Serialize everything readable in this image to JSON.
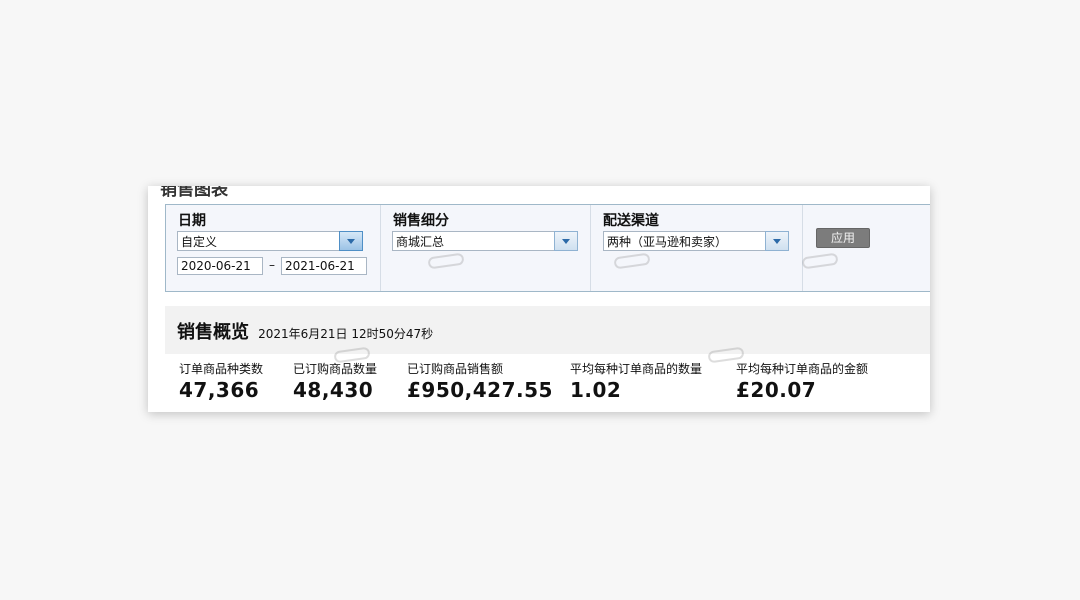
{
  "page": {
    "section_title": "销售图表"
  },
  "filters": {
    "date": {
      "label": "日期",
      "selected": "自定义",
      "start": "2020-06-21",
      "separator": "–",
      "end": "2021-06-21"
    },
    "sales_breakdown": {
      "label": "销售细分",
      "selected": "商城汇总"
    },
    "fulfillment": {
      "label": "配送渠道",
      "selected": "两种（亚马逊和卖家）"
    },
    "apply_label": "应用"
  },
  "overview": {
    "title": "销售概览",
    "timestamp": "2021年6月21日 12时50分47秒",
    "metrics": [
      {
        "label": "订单商品种类数",
        "value": "47,366"
      },
      {
        "label": "已订购商品数量",
        "value": "48,430"
      },
      {
        "label": "已订购商品销售额",
        "value": "£950,427.55"
      },
      {
        "label": "平均每种订单商品的数量",
        "value": "1.02"
      },
      {
        "label": "平均每种订单商品的金额",
        "value": "£20.07"
      }
    ]
  },
  "icons": {
    "dropdown": "chevron-down-icon"
  }
}
